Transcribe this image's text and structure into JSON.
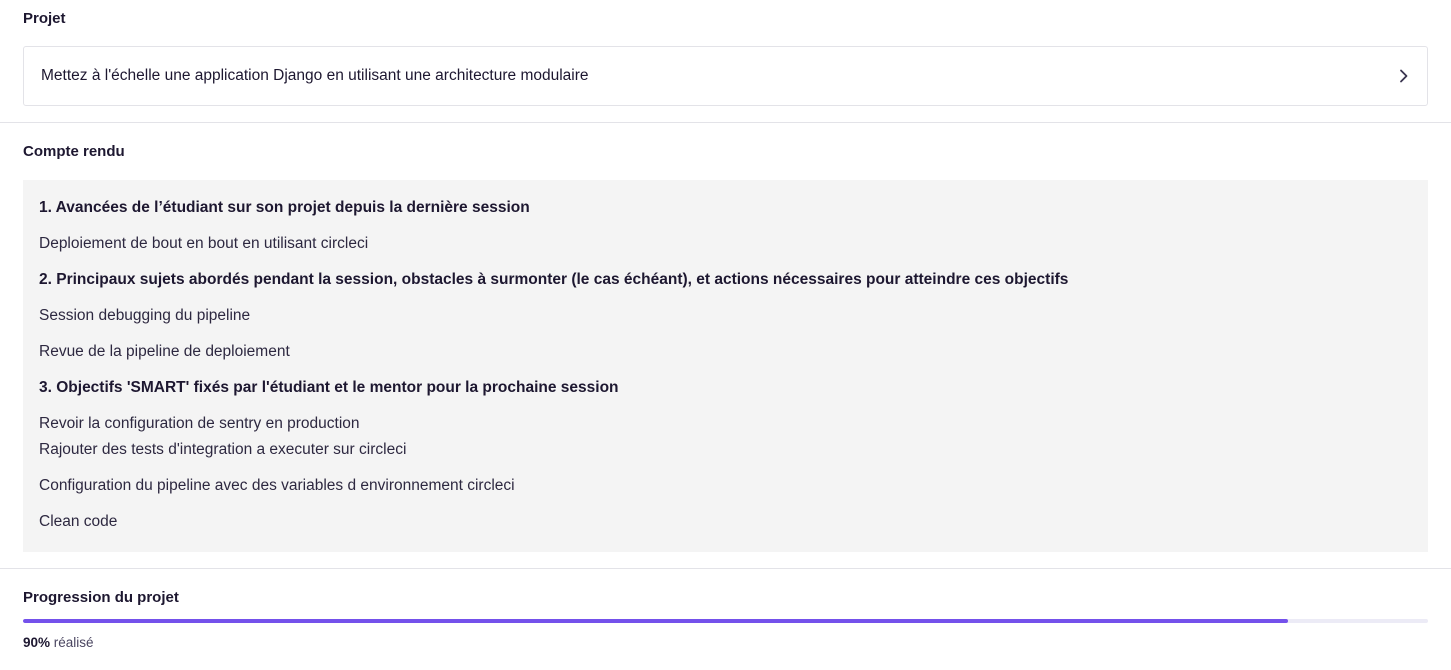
{
  "projet": {
    "title": "Projet",
    "card_label": "Mettez à l'échelle une application Django en utilisant une architecture modulaire"
  },
  "compte_rendu": {
    "title": "Compte rendu",
    "items": [
      {
        "kind": "heading",
        "text": "1. Avancées de l’étudiant sur son projet depuis la dernière session"
      },
      {
        "kind": "line",
        "text": "Deploiement de bout en bout en utilisant circleci"
      },
      {
        "kind": "heading",
        "text": "2. Principaux sujets abordés pendant la session, obstacles à surmonter (le cas échéant), et actions nécessaires pour atteindre ces objectifs"
      },
      {
        "kind": "line",
        "text": "Session debugging  du pipeline"
      },
      {
        "kind": "line",
        "text": "Revue de la pipeline de deploiement"
      },
      {
        "kind": "heading",
        "text": "3. Objectifs 'SMART' fixés par l'étudiant et le mentor pour la prochaine session"
      },
      {
        "kind": "line-tight",
        "text": "Revoir la configuration de sentry en production"
      },
      {
        "kind": "line",
        "text": "Rajouter des tests d'integration a executer sur circleci"
      },
      {
        "kind": "line",
        "text": "Configuration du pipeline avec des variables d environnement circleci"
      },
      {
        "kind": "line",
        "text": "Clean code"
      }
    ]
  },
  "progression": {
    "title": "Progression du projet",
    "percent": 90,
    "percent_label": "90%",
    "suffix": "réalisé",
    "fill_color": "#7451eb",
    "track_color": "#ecebf6"
  },
  "icons": {
    "card_chevron": "chevron-right-icon"
  }
}
